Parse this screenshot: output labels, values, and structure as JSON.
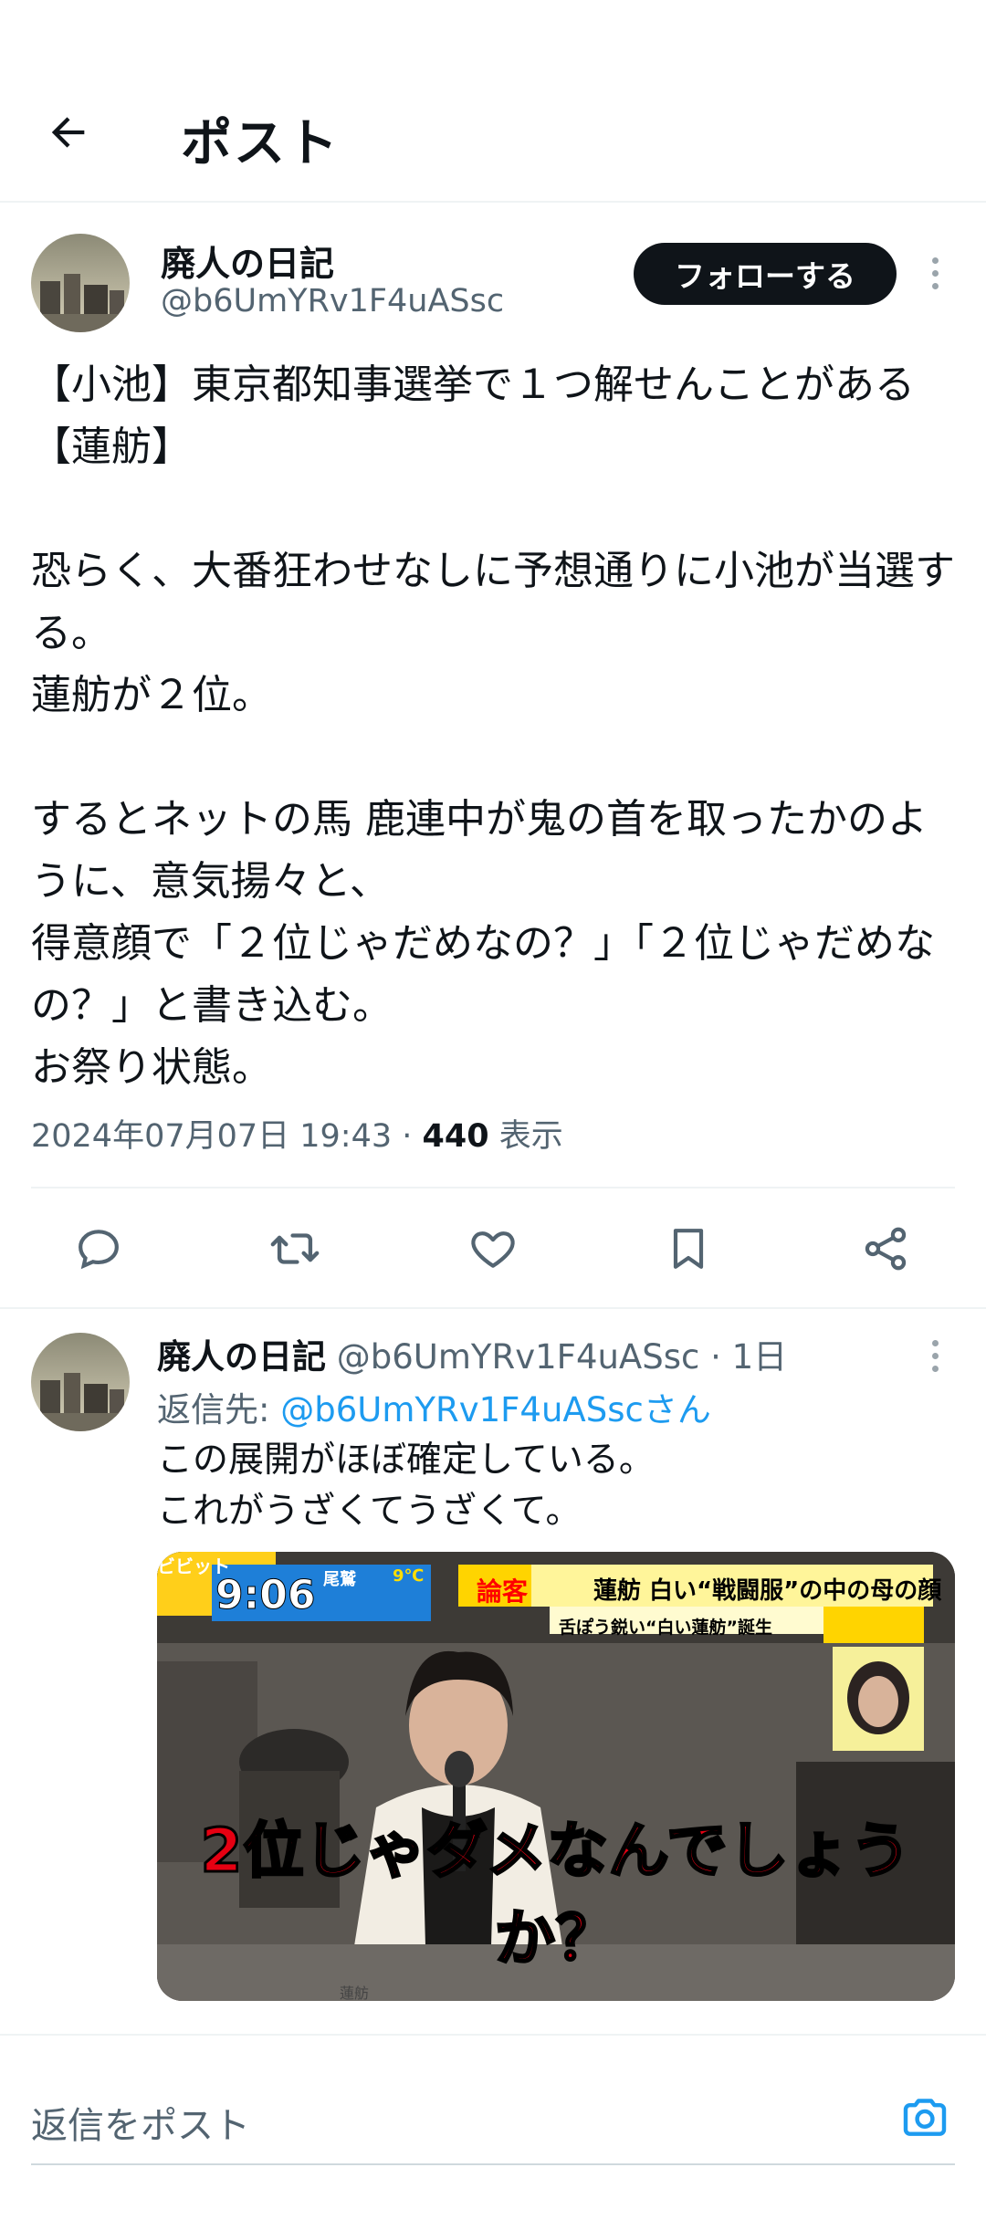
{
  "header": {
    "title": "ポスト"
  },
  "post": {
    "author_name": "廃人の日記",
    "author_handle": "@b6UmYRv1F4uASsc",
    "follow_label": "フォローする",
    "text": "【小池】東京都知事選挙で１つ解せんことがある【蓮舫】\n\n恐らく、大番狂わせなしに予想通りに小池が当選する。\n蓮舫が２位。\n\nするとネットの馬 鹿連中が鬼の首を取ったかのように、意気揚々と、\n得意顔で「２位じゃだめなの？」「２位じゃだめなの？」と書き込む。\nお祭り状態。",
    "timestamp": "2024年07月07日 19:43",
    "separator": " · ",
    "views_count": "440",
    "views_label": " 表示"
  },
  "actions": [
    "reply-icon",
    "repost-icon",
    "like-icon",
    "bookmark-icon",
    "share-icon"
  ],
  "reply": {
    "author_name": "廃人の日記",
    "author_handle": " @b6UmYRv1F4uASsc",
    "time": " · 1日",
    "reply_to_label": "返信先: ",
    "reply_to_handle": "@b6UmYRv1F4uASscさん",
    "text": "この展開がほぼ確定している。\nこれがうざくてうざくて。",
    "media": {
      "show_logo": "ビビット",
      "clock": "9:06",
      "weather_city": "尾鷲",
      "weather_temp": "9℃",
      "topic_tag": "論客",
      "topic_title": "蓮舫 白い“戦闘服”の中の母の顔",
      "topic_sub": "舌ぽう鋭い“白い蓮舫”誕生",
      "nameplate": "蓮舫",
      "caption": "2位じゃダメなんでしょうか？"
    }
  },
  "compose": {
    "placeholder": "返信をポスト"
  },
  "colors": {
    "accent": "#1d9bf0",
    "text": "#0f1419",
    "secondary": "#536471",
    "follow_bg": "#0f1419"
  }
}
